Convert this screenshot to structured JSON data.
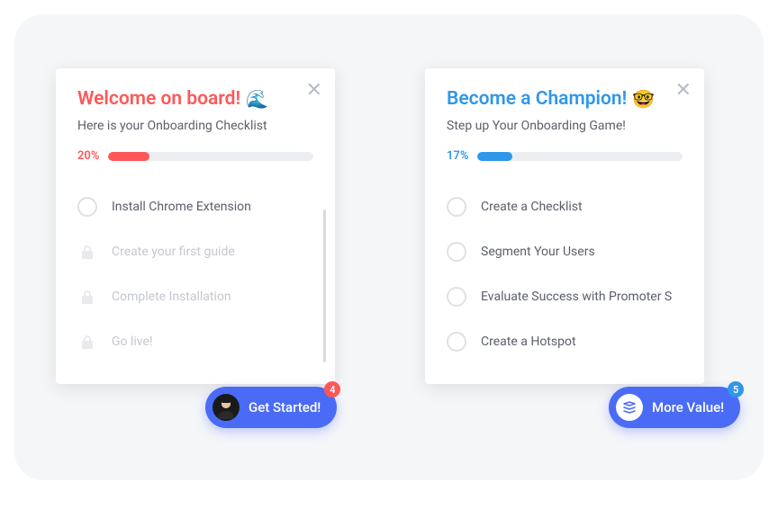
{
  "leftCard": {
    "title": "Welcome on board!",
    "emoji": "🌊",
    "subtitle": "Here is your Onboarding Checklist",
    "progressPercent": "20%",
    "items": [
      {
        "label": "Install Chrome Extension",
        "locked": false
      },
      {
        "label": "Create your first guide",
        "locked": true
      },
      {
        "label": "Complete Installation",
        "locked": true
      },
      {
        "label": "Go live!",
        "locked": true
      }
    ]
  },
  "rightCard": {
    "title": "Become a Champion!",
    "emoji": "🤓",
    "subtitle": "Step up Your Onboarding Game!",
    "progressPercent": "17%",
    "items": [
      {
        "label": "Create a Checklist",
        "locked": false
      },
      {
        "label": "Segment Your Users",
        "locked": false
      },
      {
        "label": "Evaluate Success with Promoter S",
        "locked": false
      },
      {
        "label": "Create a Hotspot",
        "locked": false
      }
    ]
  },
  "leftCta": {
    "label": "Get Started!",
    "badge": "4"
  },
  "rightCta": {
    "label": "More Value!",
    "badge": "5"
  }
}
